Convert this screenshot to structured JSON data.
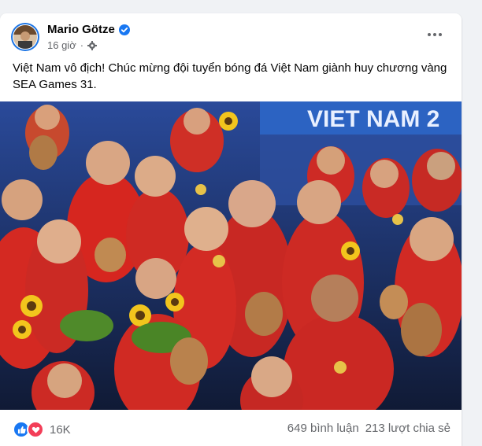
{
  "post": {
    "author": "Mario Götze",
    "time": "16 giờ",
    "separator": "·",
    "caption": "Việt Nam vô địch! Chúc mừng đội tuyển bóng đá Việt Nam giành huy chương vàng SEA Games 31.",
    "photo_banner_text": "VIET NAM 2",
    "reactions_count": "16K",
    "comments": "649 bình luận",
    "shares": "213 lượt chia sẻ"
  },
  "icons": {
    "verified": "verified-badge-icon",
    "privacy": "gear-icon",
    "more": "more-options-icon",
    "like": "like-icon",
    "love": "love-icon"
  },
  "colors": {
    "accent": "#1877f2",
    "love": "#f33e58",
    "jersey": "#d6261f",
    "background": "#f0f2f5"
  }
}
